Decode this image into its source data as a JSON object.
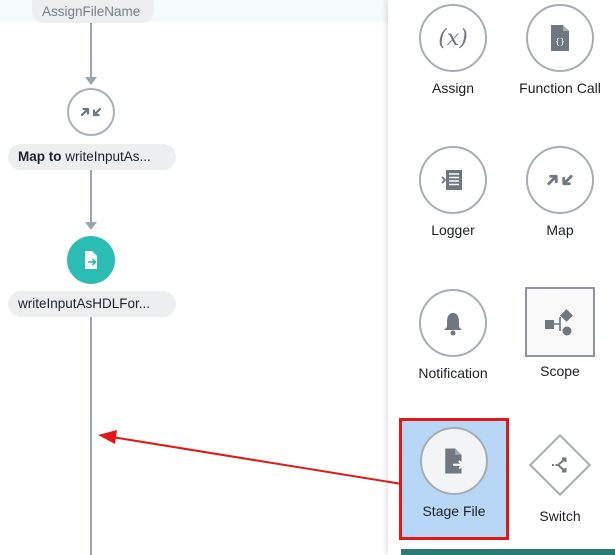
{
  "canvas": {
    "nodes": [
      {
        "label": "AssignFileName"
      },
      {
        "prefix": "Map to",
        "label": "writeInputAs..."
      },
      {
        "label": "writeInputAsHDLFor..."
      }
    ]
  },
  "palette": {
    "items": [
      {
        "label": "Assign",
        "icon": "assign-icon"
      },
      {
        "label": "Function Call",
        "icon": "function-call-icon"
      },
      {
        "label": "Logger",
        "icon": "logger-icon"
      },
      {
        "label": "Map",
        "icon": "map-icon"
      },
      {
        "label": "Notification",
        "icon": "notification-icon"
      },
      {
        "label": "Scope",
        "icon": "scope-icon"
      },
      {
        "label": "Stage File",
        "icon": "stage-file-icon",
        "selected": true
      },
      {
        "label": "Switch",
        "icon": "switch-icon"
      }
    ]
  },
  "colors": {
    "connector": "#9aa5b1",
    "stage_node": "#2bbdb3",
    "selection_outline": "#e01818",
    "selection_fill": "#b8d6f6",
    "drag_arrow": "#e01818"
  }
}
